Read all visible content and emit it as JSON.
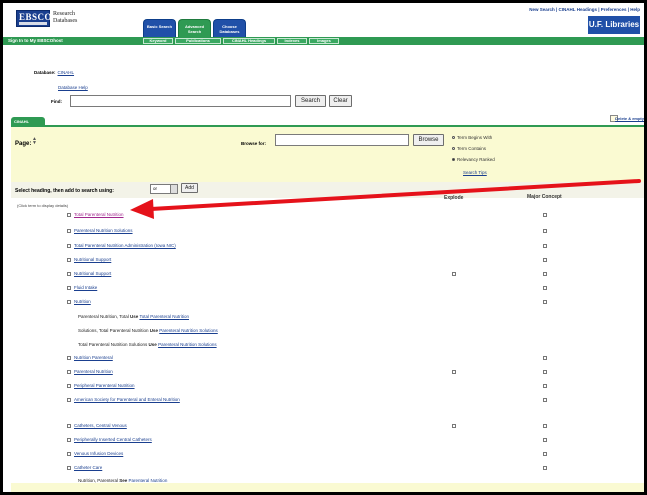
{
  "header": {
    "logo_text": "EBSCO",
    "logo_sub": [
      "Research",
      "Databases"
    ],
    "tabs": [
      {
        "label": "Basic Search",
        "active": false
      },
      {
        "label": "Advanced Search",
        "active": true
      },
      {
        "label": "Choose Databases",
        "active": false
      }
    ],
    "top_links": "New Search | CINAHL Headings | Preferences | Help",
    "library": "U.F. Libraries"
  },
  "nav": {
    "sign_in": "Sign In to My EBSCOhost",
    "items": [
      "Keyword",
      "Publications",
      "CINAHL Headings",
      "Indexes",
      "Images"
    ]
  },
  "search": {
    "database_label": "Database:",
    "database_name": "CINAHL",
    "database_help": "Database Help",
    "find_label": "Find:",
    "find_value": "",
    "search_label": "Search",
    "clear_label": "Clear"
  },
  "panel": {
    "tab_label": "CINAHL Headings",
    "delete_label": "Delete & empty",
    "page_label": "Page:",
    "browse_label": "Browse for:",
    "browse_value": "",
    "browse_button": "Browse",
    "radios": [
      {
        "label": "Term Begins With",
        "checked": false
      },
      {
        "label": "Term Contains",
        "checked": false
      },
      {
        "label": "Relevancy Ranked",
        "checked": true
      }
    ],
    "search_tips": "Search Tips"
  },
  "selection": {
    "label": "Select heading, then add to search using:",
    "operator": "or",
    "add_label": "Add",
    "explode_header": "Explode",
    "major_header": "Major Concept",
    "note": "(Click term to display details)"
  },
  "headings": [
    {
      "label": "Total Parenteral Nutrition",
      "visited": true,
      "explode": false,
      "major": true
    },
    {
      "label": "Parenteral Nutrition Solutions",
      "visited": false,
      "explode": false,
      "major": true
    },
    {
      "label": "Total Parenteral Nutrition Administration (Iowa NIC)",
      "visited": false,
      "explode": false,
      "major": true
    },
    {
      "label": "Nutritional Support",
      "visited": false,
      "explode": false,
      "major": true
    },
    {
      "label": "Nutritional Support",
      "visited": false,
      "explode": true,
      "major": true
    },
    {
      "label": "Fluid Intake",
      "visited": false,
      "explode": false,
      "major": true
    },
    {
      "label": "Nutrition",
      "visited": false,
      "explode": false,
      "major": true
    }
  ],
  "see_refs": [
    {
      "term": "Parenteral Nutrition, Total",
      "use": "Use",
      "target": "Total Parenteral Nutrition"
    },
    {
      "term": "Solutions, Total Parenteral Nutrition",
      "use": "Use",
      "target": "Parenteral Nutrition Solutions"
    },
    {
      "term": "Total Parenteral Nutrition Solutions",
      "use": "Use",
      "target": "Parenteral Nutrition Solutions"
    }
  ],
  "headings2": [
    {
      "label": "Nutrition Parenteral",
      "explode": false,
      "major": true
    },
    {
      "label": "Parenteral Nutrition",
      "explode": true,
      "major": true
    },
    {
      "label": "Peripheral Parenteral Nutrition",
      "explode": false,
      "major": true
    },
    {
      "label": "American Society for Parenteral and Enteral Nutrition",
      "explode": false,
      "major": true
    }
  ],
  "headings3": [
    {
      "label": "Catheters, Central Venous",
      "explode": true,
      "major": true
    },
    {
      "label": "Peripherally Inserted Central Catheters",
      "explode": false,
      "major": true
    },
    {
      "label": "Venous Infusion Devices",
      "explode": false,
      "major": true
    },
    {
      "label": "Catheter Care",
      "explode": false,
      "major": true
    }
  ],
  "see_ref_last": {
    "term": "Nutrition, Parenteral",
    "use": "See",
    "target": "Parenteral Nutrition"
  },
  "colors": {
    "green": "#2f9a53",
    "blue": "#2050a8",
    "yellow_panel": "#fafad2",
    "arrow": "#e5121a"
  }
}
